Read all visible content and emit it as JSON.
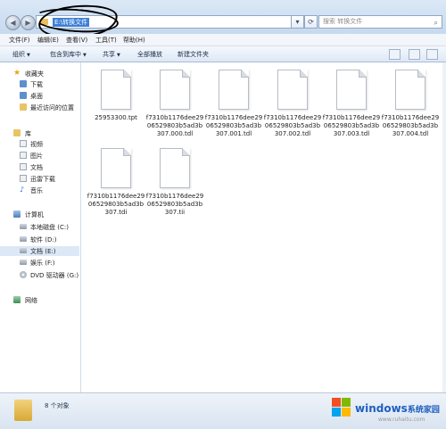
{
  "address": {
    "path": "E:\\转换文件",
    "search_placeholder": "搜索 转换文件"
  },
  "menu": [
    "文件(F)",
    "编辑(E)",
    "查看(V)",
    "工具(T)",
    "帮助(H)"
  ],
  "toolbar": {
    "organize": "组织",
    "include": "包含到库中",
    "share": "共享",
    "play_all": "全部播放",
    "new_folder": "新建文件夹"
  },
  "sidebar": {
    "favorites": "收藏夹",
    "downloads": "下载",
    "desktop": "桌面",
    "recent": "最近访问的位置",
    "libraries": "库",
    "videos": "视频",
    "pictures": "图片",
    "documents": "文档",
    "xunlei": "迅雷下载",
    "music": "音乐",
    "computer": "计算机",
    "drive_c": "本地磁盘 (C:)",
    "drive_d": "软件 (D:)",
    "drive_e": "文档 (E:)",
    "drive_f": "娱乐 (F:)",
    "drive_g": "DVD 驱动器 (G:)",
    "network": "网络"
  },
  "files": [
    {
      "name": "25953300.tpt"
    },
    {
      "name": "f7310b1176dee2906529803b5ad3b307.000.tdl"
    },
    {
      "name": "f7310b1176dee2906529803b5ad3b307.001.tdl"
    },
    {
      "name": "f7310b1176dee2906529803b5ad3b307.002.tdl"
    },
    {
      "name": "f7310b1176dee2906529803b5ad3b307.003.tdl"
    },
    {
      "name": "f7310b1176dee2906529803b5ad3b307.004.tdl"
    },
    {
      "name": "f7310b1176dee2906529803b5ad3b307.tdi"
    },
    {
      "name": "f7310b1176dee2906529803b5ad3b307.tii"
    }
  ],
  "status": {
    "count": "8 个对象"
  },
  "watermark": {
    "brand": "windows",
    "cn": "系统家园",
    "url": "www.ruhaitu.com"
  }
}
